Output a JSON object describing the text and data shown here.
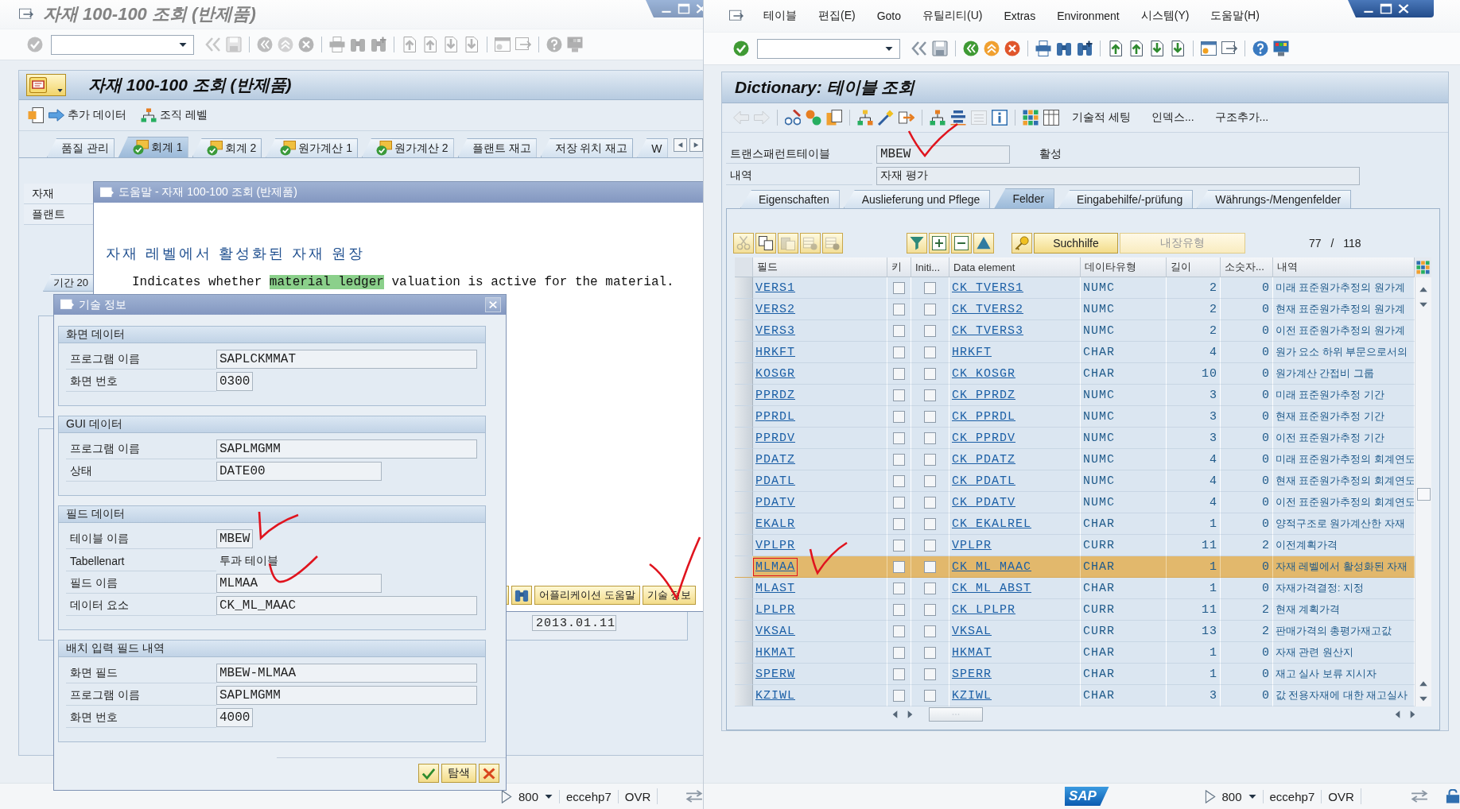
{
  "left_window": {
    "active": false,
    "title": "자재 100-100 조회 (반제품)",
    "screen_title": "자재 100-100 조회 (반제품)",
    "actions": [
      "추가 데이터",
      "조직 레벨"
    ],
    "tabs": [
      {
        "label": "품질 관리",
        "complete": false,
        "selected": false
      },
      {
        "label": "회계 1",
        "complete": true,
        "selected": true
      },
      {
        "label": "회계 2",
        "complete": true,
        "selected": false
      },
      {
        "label": "원가계산 1",
        "complete": true,
        "selected": false
      },
      {
        "label": "원가계산 2",
        "complete": true,
        "selected": false
      },
      {
        "label": "플랜트 재고",
        "complete": false,
        "selected": false
      },
      {
        "label": "저장 위치 재고",
        "complete": false,
        "selected": false
      },
      {
        "label": "W",
        "complete": false,
        "selected": false
      }
    ],
    "fields": [
      "자재",
      "플랜트"
    ],
    "subtab": "기간 20",
    "date_value": "2013.01.11",
    "status_bar": {
      "client": "800",
      "system": "eccehp7",
      "mode": "OVR"
    }
  },
  "help_dialog": {
    "title": "도움말 - 자재 100-100 조회 (반제품)",
    "heading": "자재 레벨에서 활성화된 자재 원장",
    "text": [
      {
        "text": "Indicates whether ",
        "highlighted": false
      },
      {
        "text": "material ledger",
        "highlighted": true
      },
      {
        "text": " valuation is active for the material.",
        "highlighted": false
      }
    ],
    "buttons": [
      "어플리케이션 도움말",
      "기술 정보"
    ]
  },
  "tech_dialog": {
    "title": "기술 정보",
    "groups": [
      {
        "title": "화면 데이터",
        "rows": [
          {
            "label": "프로그램 이름",
            "value": "SAPLCKMMAT",
            "kind": "field"
          },
          {
            "label": "화면 번호",
            "value": "0300",
            "kind": "field"
          }
        ]
      },
      {
        "title": "GUI 데이터",
        "rows": [
          {
            "label": "프로그램 이름",
            "value": "SAPLMGMM",
            "kind": "field"
          },
          {
            "label": "상태",
            "value": "DATE00",
            "kind": "field"
          }
        ]
      },
      {
        "title": "필드 데이터",
        "rows": [
          {
            "label": "테이블 이름",
            "value": "MBEW",
            "kind": "field"
          },
          {
            "label": "Tabellenart",
            "value": "투과 테이블",
            "kind": "text"
          },
          {
            "label": "필드 이름",
            "value": "MLMAA",
            "kind": "field"
          },
          {
            "label": "데이터 요소",
            "value": "CK_ML_MAAC",
            "kind": "field"
          }
        ]
      },
      {
        "title": "배치 입력 필드 내역",
        "rows": [
          {
            "label": "화면 필드",
            "value": "MBEW-MLMAA",
            "kind": "field"
          },
          {
            "label": "프로그램 이름",
            "value": "SAPLMGMM",
            "kind": "field"
          },
          {
            "label": "화면 번호",
            "value": "4000",
            "kind": "field"
          }
        ]
      }
    ],
    "buttons": [
      "탐색"
    ]
  },
  "right_window": {
    "active": true,
    "menu": [
      "테이블",
      "편집(E)",
      "Goto",
      "유틸리티(U)",
      "Extras",
      "Environment",
      "시스템(Y)",
      "도움말(H)"
    ],
    "title": "Dictionary: 테이블 조회",
    "app_icons": [
      {
        "disabled": true
      },
      {
        "disabled": true
      },
      {
        "disabled": false
      },
      {
        "disabled": false
      },
      {
        "disabled": false
      },
      {
        "disabled": false
      },
      {
        "disabled": false
      },
      {
        "disabled": false
      },
      {
        "disabled": false
      },
      {
        "disabled": false
      },
      {
        "disabled": true
      },
      {
        "disabled": false
      },
      {
        "disabled": false
      },
      {
        "disabled": false
      }
    ],
    "actions": [
      "기술적 세팅",
      "인덱스...",
      "구조추가..."
    ],
    "fields": [
      {
        "label": "트랜스패런트테이블",
        "value": "MBEW",
        "status": "활성"
      },
      {
        "label": "내역",
        "value": "자재 평가"
      }
    ],
    "tabs": [
      {
        "label": "Eigenschaften",
        "selected": false
      },
      {
        "label": "Auslieferung und Pflege",
        "selected": false
      },
      {
        "label": "Felder",
        "selected": true
      },
      {
        "label": "Eingabehilfe/-prüfung",
        "selected": false
      },
      {
        "label": "Währungs-/Mengenfelder",
        "selected": false
      }
    ],
    "table_toolbar": {
      "icon_buttons": [
        {
          "disabled": true
        },
        {
          "disabled": false
        },
        {
          "disabled": true
        },
        {
          "disabled": true
        },
        {
          "disabled": true
        },
        {
          "disabled": false
        },
        {
          "disabled": false
        },
        {
          "disabled": false
        },
        {
          "disabled": false
        },
        {
          "disabled": false
        }
      ],
      "buttons": [
        {
          "label": "Suchhilfe",
          "disabled": false
        },
        {
          "label": "내장유형",
          "disabled": true
        }
      ],
      "counter": "77 / 118"
    },
    "table": {
      "columns": [
        "필드",
        "키",
        "Initi...",
        "Data element",
        "데이타유형",
        "길이",
        "소숫자...",
        "내역"
      ],
      "rows": [
        {
          "field": "VERS1",
          "key": false,
          "initial": false,
          "data_element": "CK_TVERS1",
          "data_type": "NUMC",
          "length": "2",
          "decimals": "0",
          "description": "미래 표준원가추정의 원가계",
          "selected": false
        },
        {
          "field": "VERS2",
          "key": false,
          "initial": false,
          "data_element": "CK_TVERS2",
          "data_type": "NUMC",
          "length": "2",
          "decimals": "0",
          "description": "현재 표준원가추정의 원가계",
          "selected": false
        },
        {
          "field": "VERS3",
          "key": false,
          "initial": false,
          "data_element": "CK_TVERS3",
          "data_type": "NUMC",
          "length": "2",
          "decimals": "0",
          "description": "이전 표준원가추정의 원가계",
          "selected": false
        },
        {
          "field": "HRKFT",
          "key": false,
          "initial": false,
          "data_element": "HRKFT",
          "data_type": "CHAR",
          "length": "4",
          "decimals": "0",
          "description": "원가 요소 하위 부문으로서의",
          "selected": false
        },
        {
          "field": "KOSGR",
          "key": false,
          "initial": false,
          "data_element": "CK_KOSGR",
          "data_type": "CHAR",
          "length": "10",
          "decimals": "0",
          "description": "원가계산 간접비 그룹",
          "selected": false
        },
        {
          "field": "PPRDZ",
          "key": false,
          "initial": false,
          "data_element": "CK_PPRDZ",
          "data_type": "NUMC",
          "length": "3",
          "decimals": "0",
          "description": "미래 표준원가추정 기간",
          "selected": false
        },
        {
          "field": "PPRDL",
          "key": false,
          "initial": false,
          "data_element": "CK_PPRDL",
          "data_type": "NUMC",
          "length": "3",
          "decimals": "0",
          "description": "현재 표준원가추정 기간",
          "selected": false
        },
        {
          "field": "PPRDV",
          "key": false,
          "initial": false,
          "data_element": "CK_PPRDV",
          "data_type": "NUMC",
          "length": "3",
          "decimals": "0",
          "description": "이전 표준원가추정 기간",
          "selected": false
        },
        {
          "field": "PDATZ",
          "key": false,
          "initial": false,
          "data_element": "CK_PDATZ",
          "data_type": "NUMC",
          "length": "4",
          "decimals": "0",
          "description": "미래 표준원가추정의 회계연도",
          "selected": false
        },
        {
          "field": "PDATL",
          "key": false,
          "initial": false,
          "data_element": "CK_PDATL",
          "data_type": "NUMC",
          "length": "4",
          "decimals": "0",
          "description": "현재 표준원가추정의 회계연도",
          "selected": false
        },
        {
          "field": "PDATV",
          "key": false,
          "initial": false,
          "data_element": "CK_PDATV",
          "data_type": "NUMC",
          "length": "4",
          "decimals": "0",
          "description": "이전 표준원가추정의 회계연도",
          "selected": false
        },
        {
          "field": "EKALR",
          "key": false,
          "initial": false,
          "data_element": "CK_EKALREL",
          "data_type": "CHAR",
          "length": "1",
          "decimals": "0",
          "description": "양적구조로 원가계산한 자재",
          "selected": false
        },
        {
          "field": "VPLPR",
          "key": false,
          "initial": false,
          "data_element": "VPLPR",
          "data_type": "CURR",
          "length": "11",
          "decimals": "2",
          "description": "이전계획가격",
          "selected": false
        },
        {
          "field": "MLMAA",
          "key": false,
          "initial": false,
          "data_element": "CK_ML_MAAC",
          "data_type": "CHAR",
          "length": "1",
          "decimals": "0",
          "description": "자재 레벨에서 활성화된 자재",
          "selected": true
        },
        {
          "field": "MLAST",
          "key": false,
          "initial": false,
          "data_element": "CK_ML_ABST",
          "data_type": "CHAR",
          "length": "1",
          "decimals": "0",
          "description": "자재가격결정: 지정",
          "selected": false
        },
        {
          "field": "LPLPR",
          "key": false,
          "initial": false,
          "data_element": "CK_LPLPR",
          "data_type": "CURR",
          "length": "11",
          "decimals": "2",
          "description": "현재 계획가격",
          "selected": false
        },
        {
          "field": "VKSAL",
          "key": false,
          "initial": false,
          "data_element": "VKSAL",
          "data_type": "CURR",
          "length": "13",
          "decimals": "2",
          "description": "판매가격의 총평가재고값",
          "selected": false
        },
        {
          "field": "HKMAT",
          "key": false,
          "initial": false,
          "data_element": "HKMAT",
          "data_type": "CHAR",
          "length": "1",
          "decimals": "0",
          "description": "자재 관련 원산지",
          "selected": false
        },
        {
          "field": "SPERW",
          "key": false,
          "initial": false,
          "data_element": "SPERR",
          "data_type": "CHAR",
          "length": "1",
          "decimals": "0",
          "description": "재고 실사 보류 지시자",
          "selected": false
        },
        {
          "field": "KZIWL",
          "key": false,
          "initial": false,
          "data_element": "KZIWL",
          "data_type": "CHAR",
          "length": "3",
          "decimals": "0",
          "description": "값 전용자재에 대한 재고실사",
          "selected": false
        }
      ]
    },
    "status_bar": {
      "logo": "SAP",
      "client": "800",
      "system": "eccehp7",
      "mode": "OVR"
    }
  }
}
